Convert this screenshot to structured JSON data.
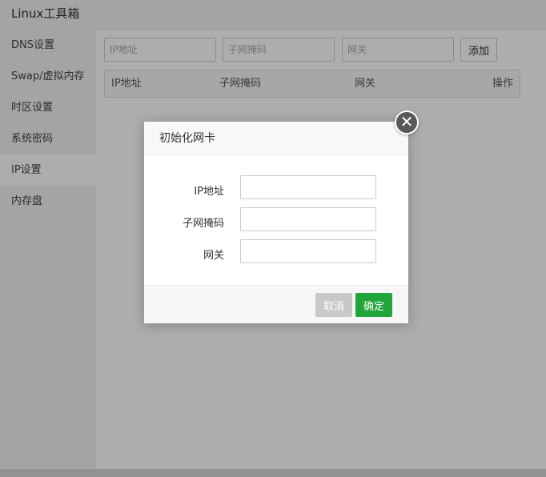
{
  "app": {
    "title": "Linux工具箱"
  },
  "sidebar": {
    "items": [
      {
        "label": "DNS设置"
      },
      {
        "label": "Swap/虚拟内存"
      },
      {
        "label": "时区设置"
      },
      {
        "label": "系统密码"
      },
      {
        "label": "IP设置",
        "active": true
      },
      {
        "label": "内存盘"
      }
    ]
  },
  "toolbar": {
    "ip_placeholder": "IP地址",
    "mask_placeholder": "子网掩码",
    "gateway_placeholder": "网关",
    "add_label": "添加"
  },
  "table": {
    "columns": [
      "IP地址",
      "子网掩码",
      "网关",
      "操作"
    ]
  },
  "dialog": {
    "title": "初始化网卡",
    "close_icon": "close-icon",
    "fields": [
      {
        "label": "IP地址",
        "value": ""
      },
      {
        "label": "子网掩码",
        "value": ""
      },
      {
        "label": "网关",
        "value": ""
      }
    ],
    "cancel_label": "取消",
    "ok_label": "确定"
  },
  "colors": {
    "accent": "#20a53a",
    "cancel": "#c8c8c8",
    "overlay": "rgba(0,0,0,0.32)"
  }
}
